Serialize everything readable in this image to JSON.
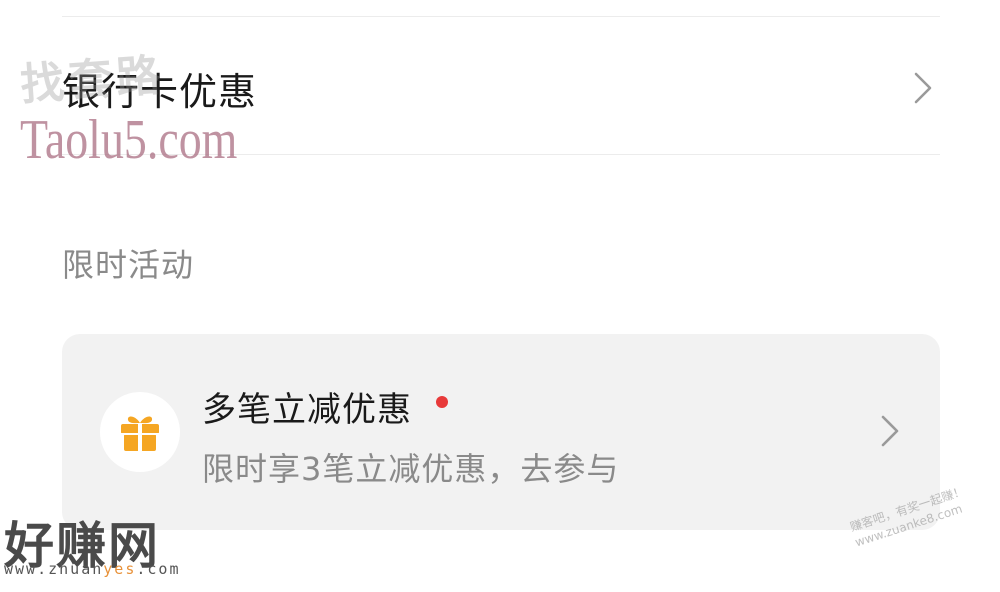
{
  "menu": {
    "bank_card_offers": {
      "label": "银行卡优惠"
    }
  },
  "section": {
    "label": "限时活动"
  },
  "activity_card": {
    "title": "多笔立减优惠",
    "subtitle": "限时享3笔立减优惠，去参与",
    "icon": "gift-icon",
    "has_new_dot": true
  },
  "watermarks": {
    "taolu_cn": "找套路",
    "taolu_url": "Taolu5.com",
    "zhuanyes_cn": "好赚网",
    "zhuanyes_url_prefix": "www.zhuan",
    "zhuanyes_url_accent": "yes",
    "zhuanyes_url_suffix": ".com",
    "zuanke_line1": "赚客吧，有奖一起赚！",
    "zuanke_line2": "www.zuanke8.com"
  },
  "colors": {
    "gift_orange": "#f5a623",
    "red_dot": "#e83a3a",
    "card_bg": "#f2f2f2",
    "muted_text": "#8a8a8a"
  }
}
